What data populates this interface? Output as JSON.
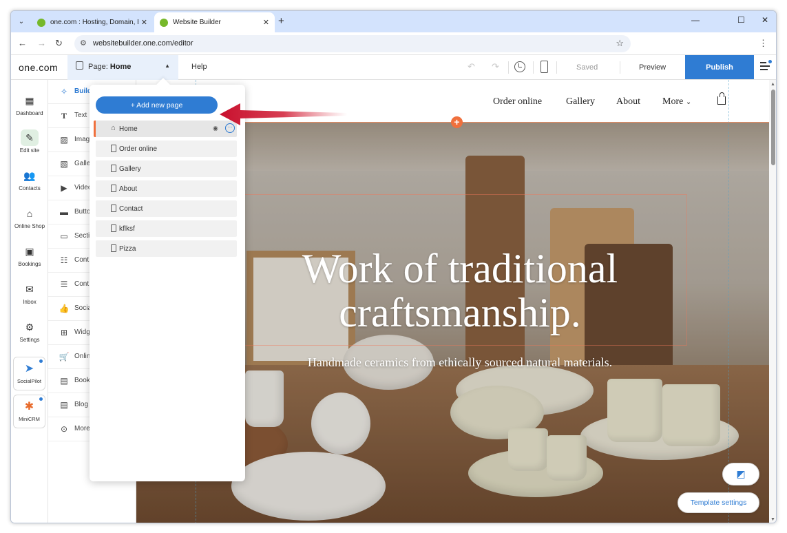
{
  "browser": {
    "tabs": [
      {
        "title": "one.com : Hosting, Domain, Em",
        "active": false
      },
      {
        "title": "Website Builder",
        "active": true
      }
    ],
    "new_tab": "+",
    "url": "websitebuilder.one.com/editor",
    "window_controls": {
      "minimize": "—",
      "maximize": "☐",
      "close": "✕"
    }
  },
  "editor": {
    "brand": "one.com",
    "page_selector": {
      "prefix": "Page:",
      "current": "Home"
    },
    "help": "Help",
    "saved": "Saved",
    "preview": "Preview",
    "publish": "Publish",
    "accent": "#2f7cd3"
  },
  "left_rail": [
    {
      "icon": "dashboard-icon",
      "label": "Dashboard"
    },
    {
      "icon": "edit-site-icon",
      "label": "Edit site",
      "active": true
    },
    {
      "icon": "contacts-icon",
      "label": "Contacts"
    },
    {
      "icon": "shop-icon",
      "label": "Online Shop"
    },
    {
      "icon": "bookings-icon",
      "label": "Bookings"
    },
    {
      "icon": "inbox-icon",
      "label": "Inbox"
    },
    {
      "icon": "settings-icon",
      "label": "Settings"
    }
  ],
  "apps": [
    {
      "icon": "socialpilot-icon",
      "label": "SocialPilot"
    },
    {
      "icon": "minicrm-icon",
      "label": "MiniCRM"
    }
  ],
  "build_panel": [
    {
      "icon": "sparkle-icon",
      "label": "Build"
    },
    {
      "icon": "text-icon",
      "label": "Text"
    },
    {
      "icon": "image-icon",
      "label": "Imag"
    },
    {
      "icon": "gallery-icon",
      "label": "Galle"
    },
    {
      "icon": "video-icon",
      "label": "Video"
    },
    {
      "icon": "button-icon",
      "label": "Butto"
    },
    {
      "icon": "section-icon",
      "label": "Secti"
    },
    {
      "icon": "contact-icon",
      "label": "Cont"
    },
    {
      "icon": "contact-form-icon",
      "label": "Cont"
    },
    {
      "icon": "social-icon",
      "label": "Socia"
    },
    {
      "icon": "widget-icon",
      "label": "Widg"
    },
    {
      "icon": "cart-icon",
      "label": "Onlin"
    },
    {
      "icon": "booking-icon",
      "label": "Book"
    },
    {
      "icon": "blog-icon",
      "label": "Blog"
    },
    {
      "icon": "more-icon",
      "label": "More"
    }
  ],
  "pages_dropdown": {
    "add_button": "+ Add new page",
    "pages": [
      {
        "name": "Home",
        "current": true
      },
      {
        "name": "Order online"
      },
      {
        "name": "Gallery"
      },
      {
        "name": "About"
      },
      {
        "name": "Contact"
      },
      {
        "name": "kflksf"
      },
      {
        "name": "Pizza"
      }
    ]
  },
  "site": {
    "nav": [
      "Order online",
      "Gallery",
      "About",
      "More"
    ],
    "headline_line1": "Work of traditional",
    "headline_line2": "craftsmanship.",
    "subheadline": "Handmade ceramics from ethically sourced natural materials.",
    "template_settings": "Template settings"
  }
}
